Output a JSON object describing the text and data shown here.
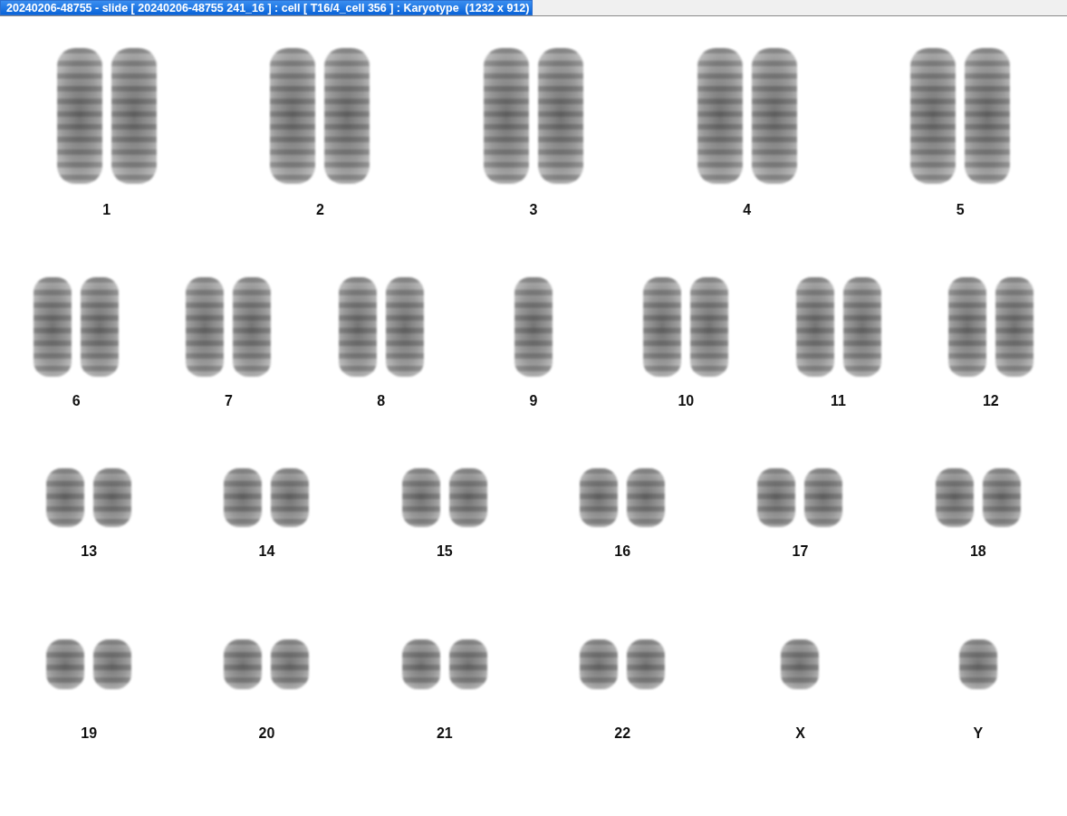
{
  "window": {
    "title": "20240206-48755 - slide [ 20240206-48755 241_16 ] : cell [ T16/4_cell 356 ] : Karyotype  (1232 x 912)"
  },
  "karyotype": {
    "rows": [
      [
        {
          "label": "1",
          "kind": "pair"
        },
        {
          "label": "2",
          "kind": "pair"
        },
        {
          "label": "3",
          "kind": "pair"
        },
        {
          "label": "4",
          "kind": "pair"
        },
        {
          "label": "5",
          "kind": "pair"
        }
      ],
      [
        {
          "label": "6",
          "kind": "pair"
        },
        {
          "label": "7",
          "kind": "pair"
        },
        {
          "label": "8",
          "kind": "pair"
        },
        {
          "label": "9",
          "kind": "single"
        },
        {
          "label": "10",
          "kind": "pair"
        },
        {
          "label": "11",
          "kind": "pair"
        },
        {
          "label": "12",
          "kind": "pair"
        }
      ],
      [
        {
          "label": "13",
          "kind": "pair"
        },
        {
          "label": "14",
          "kind": "pair"
        },
        {
          "label": "15",
          "kind": "pair"
        },
        {
          "label": "16",
          "kind": "pair"
        },
        {
          "label": "17",
          "kind": "pair"
        },
        {
          "label": "18",
          "kind": "pair"
        }
      ],
      [
        {
          "label": "19",
          "kind": "pair"
        },
        {
          "label": "20",
          "kind": "pair"
        },
        {
          "label": "21",
          "kind": "pair"
        },
        {
          "label": "22",
          "kind": "pair"
        },
        {
          "label": "X",
          "kind": "single"
        },
        {
          "label": "Y",
          "kind": "single"
        }
      ]
    ]
  }
}
